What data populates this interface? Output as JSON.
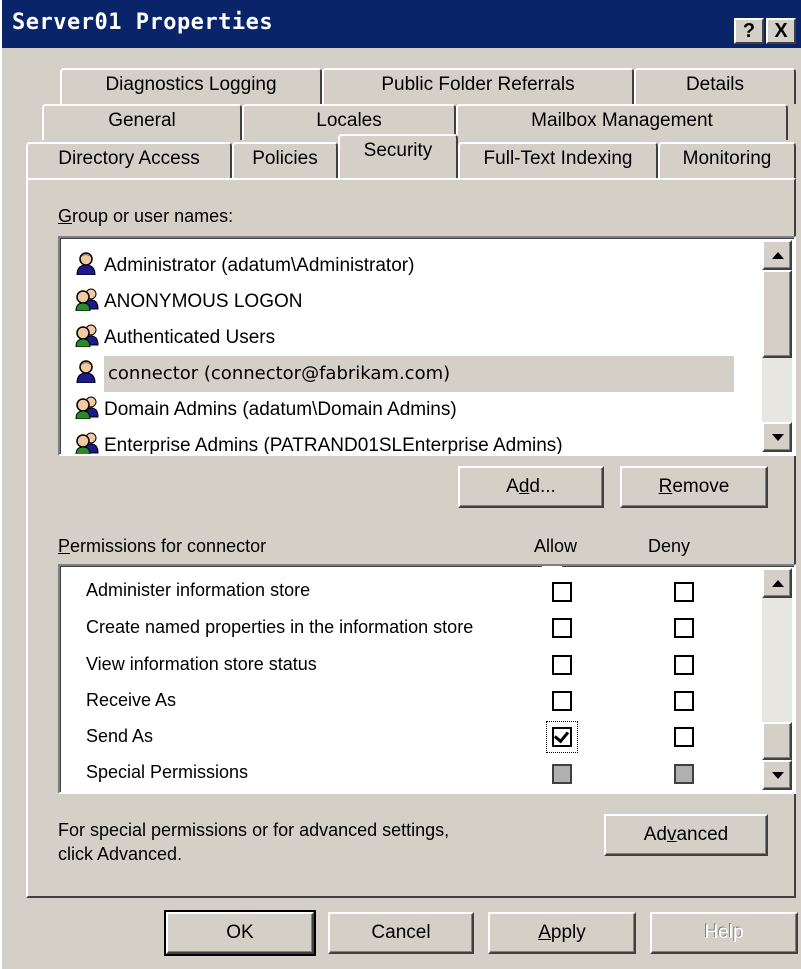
{
  "window": {
    "title": "Server01 Properties",
    "help_button": "?",
    "close_button": "X"
  },
  "tabs": {
    "row1": [
      "Diagnostics Logging",
      "Public Folder Referrals",
      "Details"
    ],
    "row2": [
      "General",
      "Locales",
      "Mailbox Management"
    ],
    "row3": [
      "Directory Access",
      "Policies",
      "Security",
      "Full-Text Indexing",
      "Monitoring"
    ],
    "active": "Security"
  },
  "group_section": {
    "label_underline": "G",
    "label_rest": "roup or user names:",
    "users": [
      {
        "name": "Administrator (adatum\\Administrator)",
        "icon": "single-user-icon",
        "selected": false
      },
      {
        "name": "ANONYMOUS LOGON",
        "icon": "group-users-icon",
        "selected": false
      },
      {
        "name": "Authenticated Users",
        "icon": "group-users-icon",
        "selected": false
      },
      {
        "name": "connector (connector@fabrikam.com)",
        "icon": "single-user-icon",
        "selected": true
      },
      {
        "name": "Domain Admins (adatum\\Domain Admins)",
        "icon": "group-users-icon",
        "selected": false
      },
      {
        "name": "Enterprise Admins (PATRAND01SLEnterprise Admins)",
        "icon": "group-users-icon",
        "selected": false
      }
    ],
    "add_pre": "A",
    "add_u": "d",
    "add_post": "d...",
    "remove_u": "R",
    "remove_post": "emove"
  },
  "permissions_section": {
    "label_underline": "P",
    "label_rest": "ermissions for connector",
    "allow_header": "Allow",
    "deny_header": "Deny",
    "items": [
      {
        "name": "Administer information store",
        "allow": "unchecked",
        "deny": "unchecked"
      },
      {
        "name": "Create named properties in the information store",
        "allow": "unchecked",
        "deny": "unchecked"
      },
      {
        "name": "View information store status",
        "allow": "unchecked",
        "deny": "unchecked"
      },
      {
        "name": "Receive As",
        "allow": "unchecked",
        "deny": "unchecked"
      },
      {
        "name": "Send As",
        "allow": "checked",
        "deny": "unchecked"
      },
      {
        "name": "Special Permissions",
        "allow": "disabled",
        "deny": "disabled"
      }
    ]
  },
  "advanced_section": {
    "text_line1": "For special permissions or for advanced settings,",
    "text_line2": "click Advanced.",
    "button_pre": "Ad",
    "button_u": "v",
    "button_post": "anced"
  },
  "footer": {
    "ok": "OK",
    "cancel": "Cancel",
    "apply_u": "A",
    "apply_post": "pply",
    "help": "Help"
  },
  "colors": {
    "titlebar": "#0a246a",
    "face": "#d4d0c8",
    "selection": "#d4d0c8"
  }
}
